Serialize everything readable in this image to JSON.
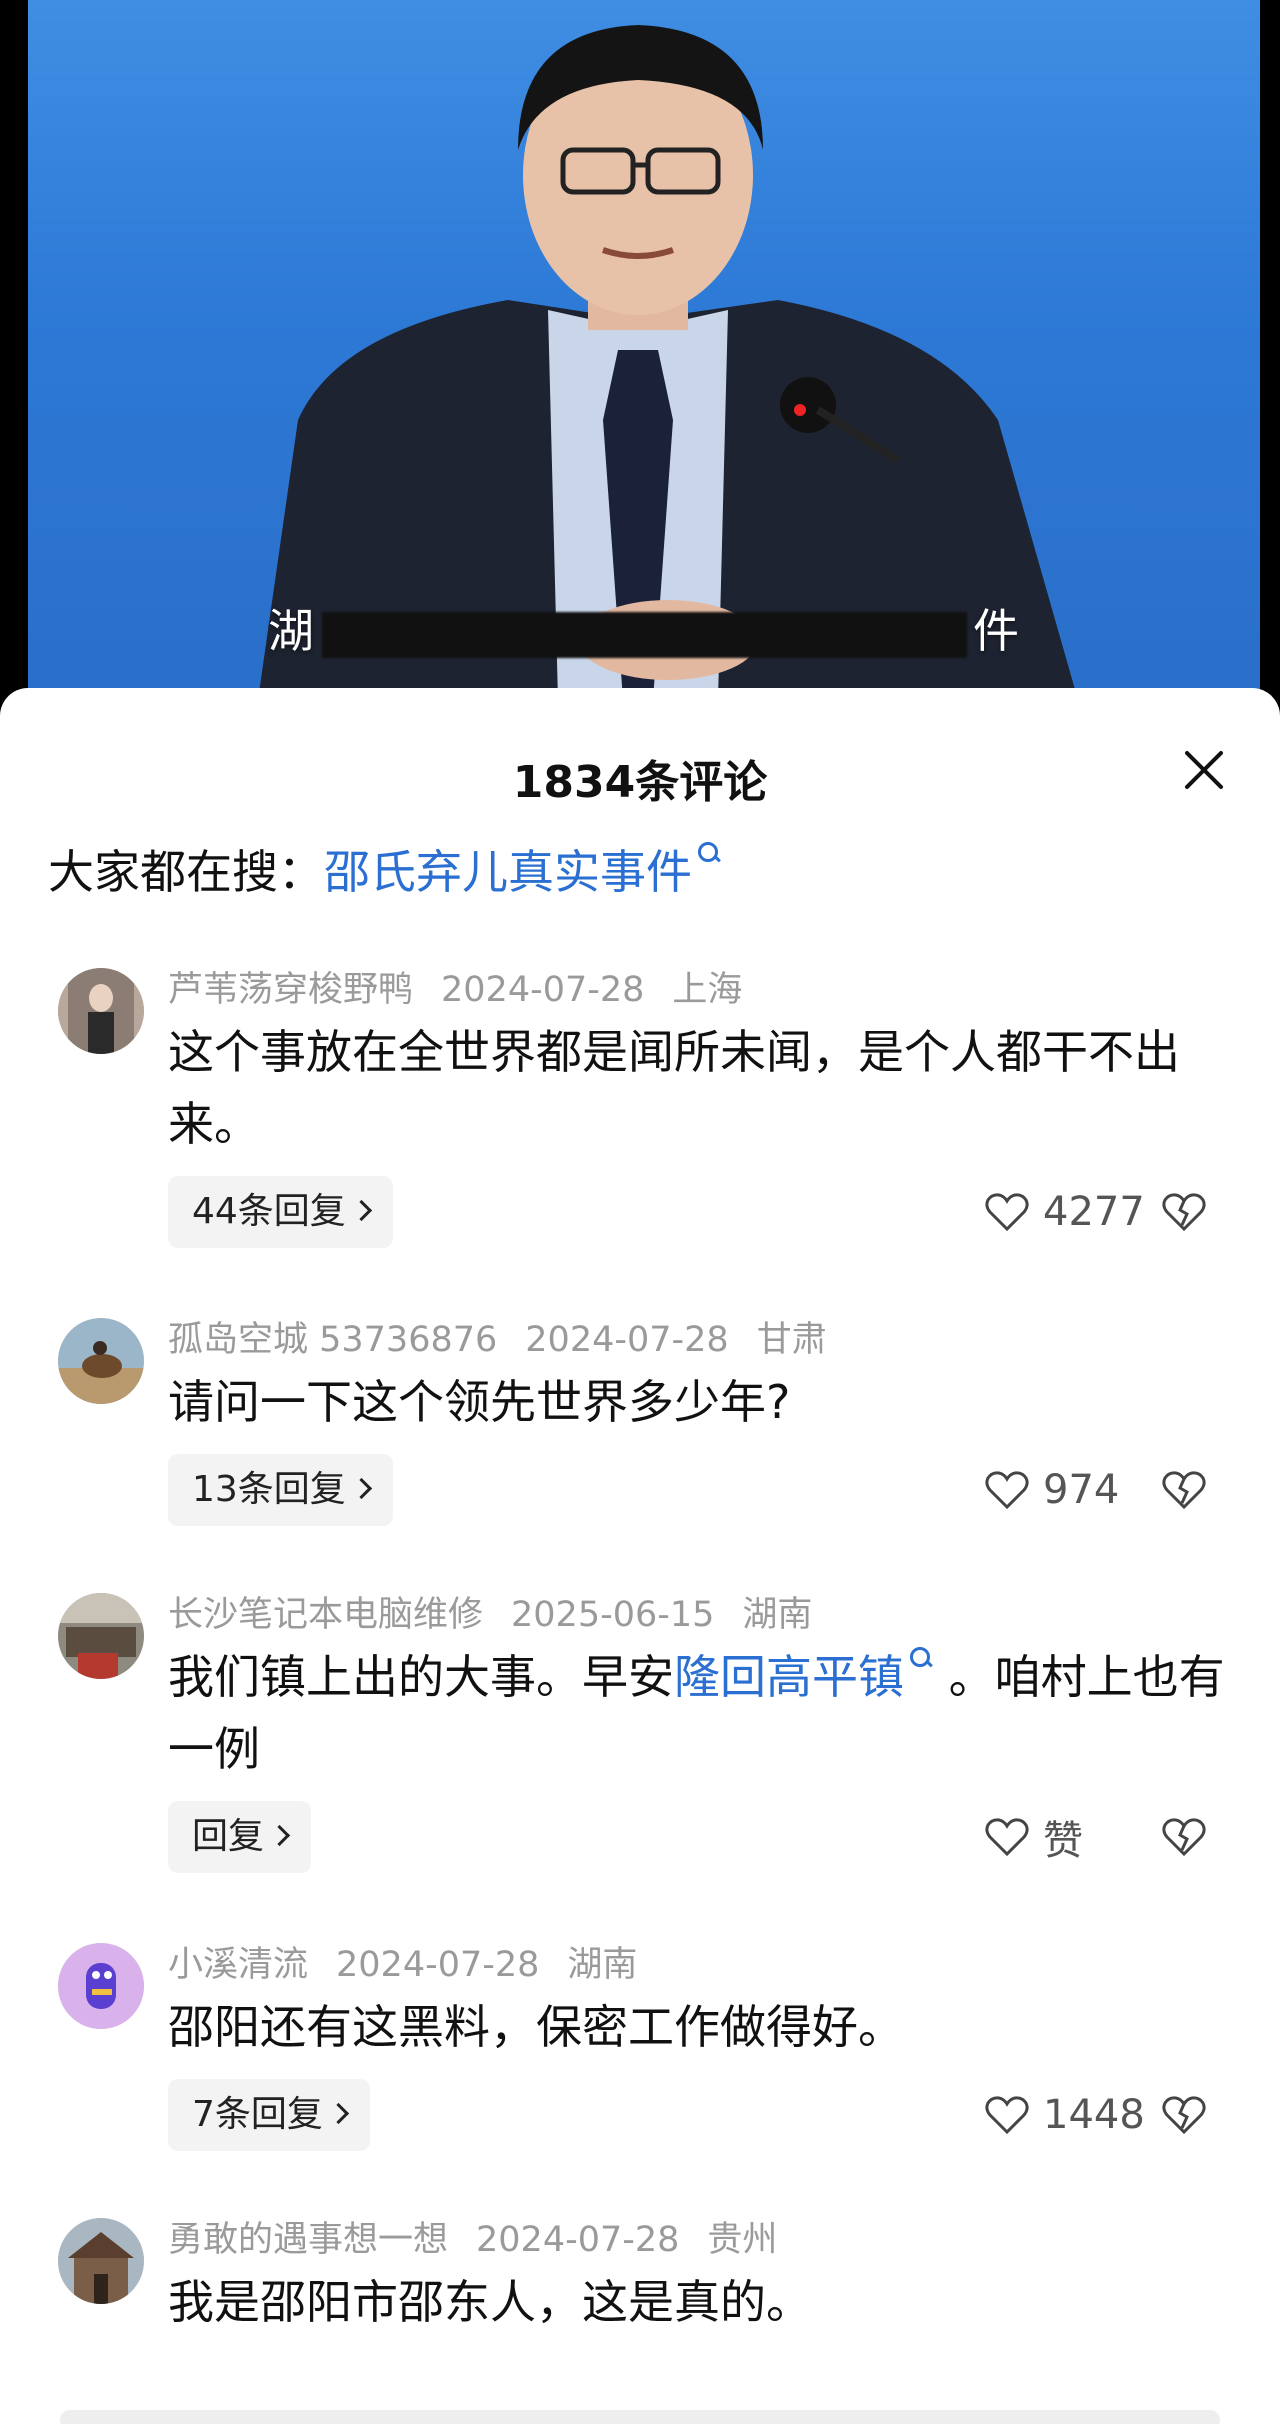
{
  "video": {
    "subtitle_start": "湖",
    "subtitle_end": "件"
  },
  "panel": {
    "comment_count": "1834条评论"
  },
  "search": {
    "prefix": "大家都在搜：",
    "link": "邵氏弃儿真实事件"
  },
  "comments": [
    {
      "user": "芦苇荡穿梭野鸭",
      "date": "2024-07-28",
      "location": "上海",
      "text": "这个事放在全世界都是闻所未闻，是个人都干不出来。",
      "reply_label": "44条回复",
      "likes": "4277"
    },
    {
      "user": "孤岛空城 53736876",
      "date": "2024-07-28",
      "location": "甘肃",
      "text": "请问一下这个领先世界多少年?",
      "reply_label": "13条回复",
      "likes": "974"
    },
    {
      "user": "长沙笔记本电脑维修",
      "date": "2025-06-15",
      "location": "湖南",
      "text_before": "我们镇上出的大事。早安",
      "text_link": "隆回高平镇",
      "text_after": " 。咱村上也有一例",
      "reply_label": "回复",
      "likes": "赞"
    },
    {
      "user": "小溪清流",
      "date": "2024-07-28",
      "location": "湖南",
      "text": "邵阳还有这黑料，保密工作做得好。",
      "reply_label": "7条回复",
      "likes": "1448"
    },
    {
      "user": "勇敢的遇事想一想",
      "date": "2024-07-28",
      "location": "贵州",
      "text": "我是邵阳市邵东人，这是真的。"
    }
  ],
  "icons": {
    "like": "heart-outline-icon",
    "dislike": "broken-heart-icon",
    "close": "close-icon",
    "search": "search-icon"
  },
  "colors": {
    "link": "#2a6fd1",
    "meta": "#9a9a9a",
    "video_bg": "#2d79d6"
  }
}
